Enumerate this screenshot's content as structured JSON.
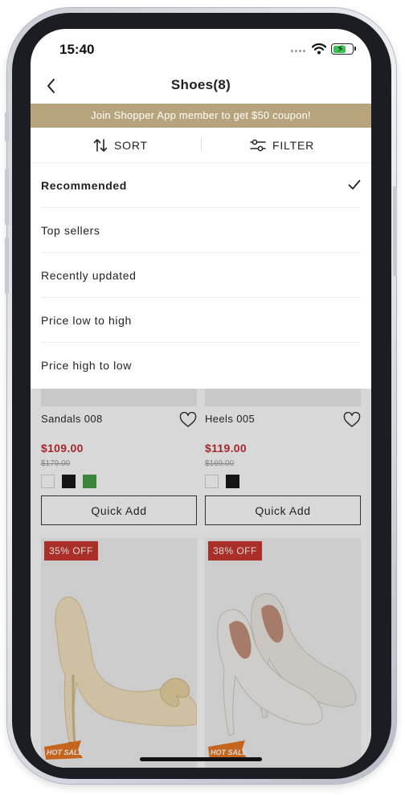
{
  "status": {
    "time": "15:40"
  },
  "nav": {
    "title": "Shoes(8)"
  },
  "banner": {
    "text": "Join Shopper App member to get $50 coupon!"
  },
  "toolbar": {
    "sort_label": "SORT",
    "filter_label": "FILTER"
  },
  "sort_options": [
    {
      "label": "Recommended",
      "selected": true
    },
    {
      "label": "Top sellers",
      "selected": false
    },
    {
      "label": "Recently updated",
      "selected": false
    },
    {
      "label": "Price low to high",
      "selected": false
    },
    {
      "label": "Price high to low",
      "selected": false
    }
  ],
  "products": [
    {
      "name": "Sandals 008",
      "price": "$109.00",
      "original_price": "$179.00",
      "colors": [
        "#ffffff",
        "#111111",
        "#3e9a3e"
      ],
      "quick_add_label": "Quick Add",
      "discount": "35% OFF",
      "hot_label": "HOT SALE"
    },
    {
      "name": "Heels 005",
      "price": "$119.00",
      "original_price": "$169.00",
      "colors": [
        "#ffffff",
        "#111111"
      ],
      "quick_add_label": "Quick Add",
      "discount": "38% OFF",
      "hot_label": "HOT SALE"
    }
  ],
  "colors": {
    "banner": "#b7a37c",
    "price": "#c0282a",
    "badge": "#c8312a"
  },
  "icons": [
    "back-chevron-icon",
    "sort-arrows-icon",
    "filter-sliders-icon",
    "checkmark-icon",
    "heart-icon",
    "wifi-icon",
    "battery-icon"
  ]
}
